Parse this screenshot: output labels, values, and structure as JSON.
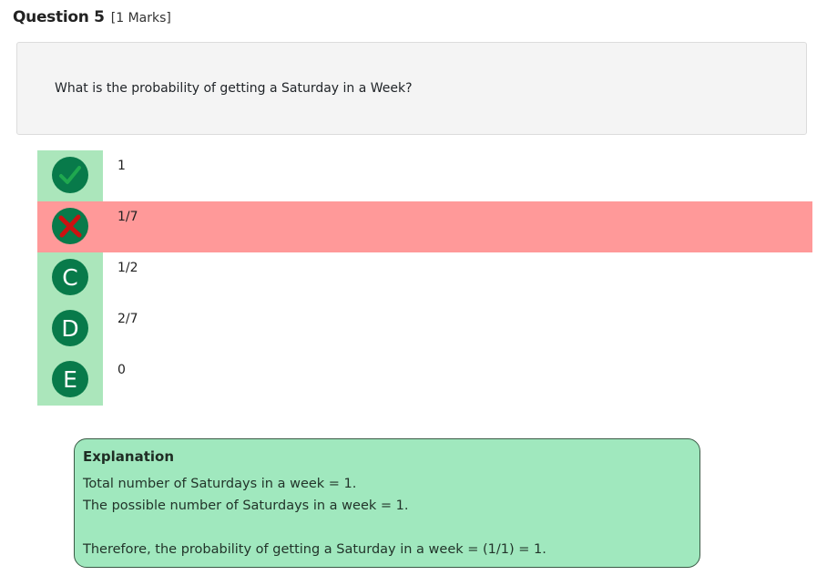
{
  "question": {
    "title": "Question 5",
    "marks": "[1 Marks]",
    "text": "What is the probability of getting a Saturday in a Week?"
  },
  "options": [
    {
      "badge": "check-icon",
      "text": "1",
      "state": "correct"
    },
    {
      "badge": "cross-icon",
      "text": "1/7",
      "state": "wrong"
    },
    {
      "badge": "C",
      "text": "1/2",
      "state": "normal"
    },
    {
      "badge": "D",
      "text": "2/7",
      "state": "normal"
    },
    {
      "badge": "E",
      "text": "0",
      "state": "normal"
    }
  ],
  "explanation": {
    "title": "Explanation",
    "line1": "Total number of Saturdays in a week = 1.",
    "line2": "The possible number of Saturdays in a week = 1.",
    "line3": "Therefore, the probability of getting a Saturday in a week = (1/1) = 1."
  },
  "colors": {
    "badge_bg": "#087a4a",
    "badge_col_bg": "#abe6bb",
    "wrong_row_bg": "#ff9999",
    "explanation_bg": "#a0e8be",
    "check_color": "#1fa84f",
    "cross_color": "#cc1111"
  }
}
